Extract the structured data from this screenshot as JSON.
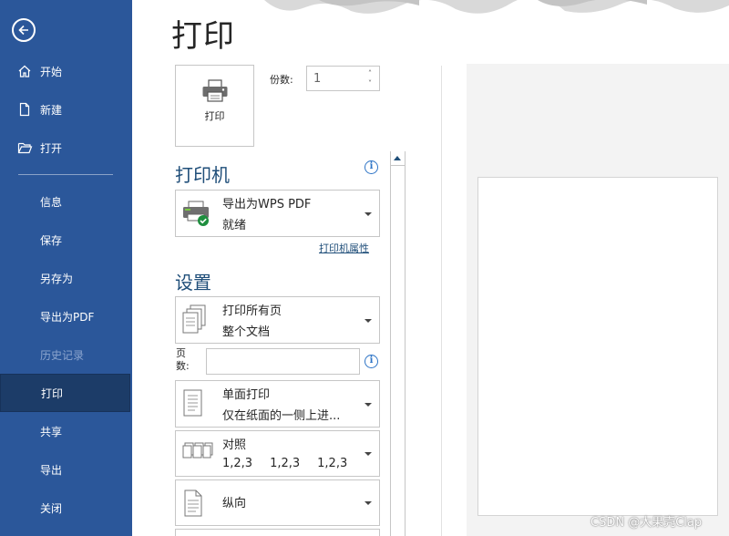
{
  "page": {
    "title": "打印"
  },
  "sidebar": {
    "top_items": [
      {
        "label": "开始",
        "icon": "home-icon"
      },
      {
        "label": "新建",
        "icon": "new-document-icon"
      },
      {
        "label": "打开",
        "icon": "open-folder-icon"
      }
    ],
    "items": [
      {
        "label": "信息"
      },
      {
        "label": "保存"
      },
      {
        "label": "另存为"
      },
      {
        "label": "导出为PDF"
      },
      {
        "label": "历史记录",
        "disabled": true
      },
      {
        "label": "打印",
        "active": true
      },
      {
        "label": "共享"
      },
      {
        "label": "导出"
      },
      {
        "label": "关闭"
      }
    ]
  },
  "print_button": {
    "label": "打印"
  },
  "copies": {
    "label": "份数:",
    "value": "1"
  },
  "printer": {
    "heading": "打印机",
    "name": "导出为WPS PDF",
    "status": "就绪",
    "properties_link": "打印机属性"
  },
  "settings": {
    "heading": "设置",
    "range": {
      "line1": "打印所有页",
      "line2": "整个文档"
    },
    "pages_label": "页数:",
    "pages_value": "",
    "sides": {
      "line1": "单面打印",
      "line2": "仅在纸面的一侧上进..."
    },
    "collate": {
      "line1": "对照",
      "nums": [
        "1,2,3",
        "1,2,3",
        "1,2,3"
      ]
    },
    "orientation": {
      "line1": "纵向"
    }
  },
  "watermark": "CSDN @大果壳Clap",
  "colors": {
    "sidebar": "#2b579a",
    "active": "#1c3c68",
    "accent": "#1f4e79"
  }
}
